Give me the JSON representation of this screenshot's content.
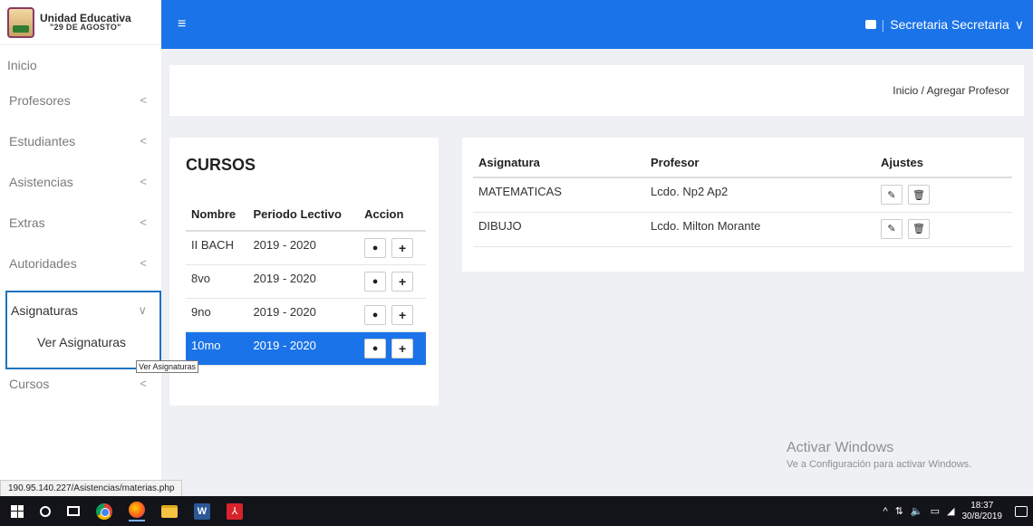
{
  "brand": {
    "name": "Unidad Educativa",
    "subtitle": "\"29 DE AGOSTO\""
  },
  "topbar": {
    "menu_icon": "hamburger-icon",
    "user_name": "Secretaria Secretaria",
    "user_chevron": "∨",
    "separator": "|"
  },
  "sidebar": {
    "home": "Inicio",
    "items": [
      {
        "label": "Profesores",
        "chevron": "<"
      },
      {
        "label": "Estudiantes",
        "chevron": "<"
      },
      {
        "label": "Asistencias",
        "chevron": "<"
      },
      {
        "label": "Extras",
        "chevron": "<"
      },
      {
        "label": "Autoridades",
        "chevron": "<"
      }
    ],
    "active": {
      "label": "Asignaturas",
      "chevron": "∨",
      "subitem": "Ver Asignaturas"
    },
    "after": {
      "label": "Cursos",
      "chevron": "<"
    },
    "tooltip": "Ver Asignaturas"
  },
  "breadcrumb": {
    "text": "Inicio / Agregar Profesor"
  },
  "cursos": {
    "title": "CURSOS",
    "headers": [
      "Nombre",
      "Periodo Lectivo",
      "Accion"
    ],
    "rows": [
      {
        "nombre": "II BACH",
        "periodo": "2019 - 2020"
      },
      {
        "nombre": "8vo",
        "periodo": "2019 - 2020"
      },
      {
        "nombre": "9no",
        "periodo": "2019 - 2020"
      },
      {
        "nombre": "10mo",
        "periodo": "2019 - 2020"
      }
    ],
    "view_glyph": "●",
    "add_glyph": "+"
  },
  "asignaturas": {
    "headers": [
      "Asignatura",
      "Profesor",
      "Ajustes"
    ],
    "rows": [
      {
        "asignatura": "MATEMATICAS",
        "profesor": "Lcdo. Np2 Ap2"
      },
      {
        "asignatura": "DIBUJO",
        "profesor": "Lcdo. Milton Morante"
      }
    ],
    "edit_glyph": "✎",
    "delete_glyph": "🗑"
  },
  "activate_windows": {
    "title": "Activar Windows",
    "subtitle": "Ve a Configuración para activar Windows."
  },
  "status_url": "190.95.140.227/Asistencias/materias.php",
  "taskbar": {
    "tray": "^",
    "time": "18:37",
    "date": "30/8/2019",
    "word_letter": "W",
    "pdf_letter": "⅄"
  },
  "colors": {
    "primary": "#1a73e8",
    "active_border": "#1e73be",
    "background": "#eef0f3"
  }
}
